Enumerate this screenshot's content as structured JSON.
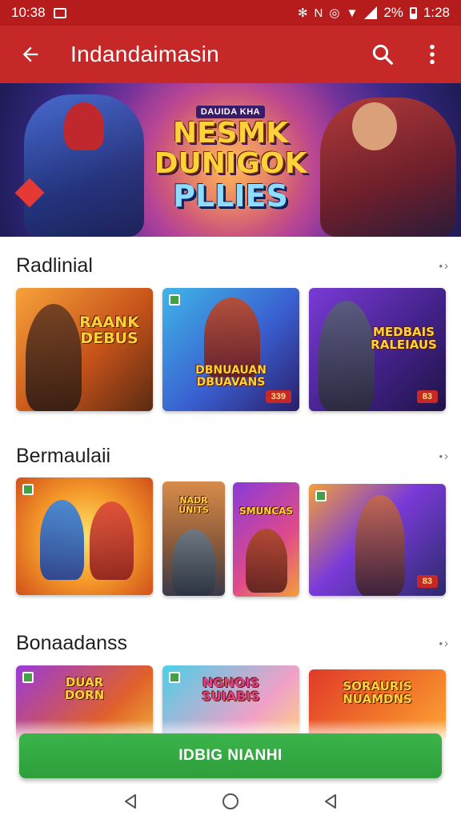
{
  "status_bar": {
    "time": "10:38",
    "battery": "2%",
    "clock_right": "1:28"
  },
  "app_bar": {
    "title": "Indandaimasin"
  },
  "hero": {
    "logo_small": "DAUIDA KHA",
    "logo_line1": "NESMK",
    "logo_line2": "DUNIGOK",
    "logo_line3": "PLLIES"
  },
  "sections": [
    {
      "title": "Radlinial",
      "more": "»",
      "cards": [
        {
          "text": "RAANK\nDEBUS",
          "badge": ""
        },
        {
          "text": "DBNUAUAN\nDBUAVANS",
          "badge": "339"
        },
        {
          "text": "MEDBAIS\nRALEIAUS",
          "badge": "83"
        }
      ]
    },
    {
      "title": "Bermaulaii",
      "more": "»",
      "cards": [
        {
          "text": "",
          "badge": ""
        },
        {
          "text": "NADR\nUNITS",
          "badge": ""
        },
        {
          "text": "SMUNCAS",
          "badge": ""
        },
        {
          "text": "",
          "badge": "83"
        }
      ]
    },
    {
      "title": "Bonaadanss",
      "more": "»",
      "cards": [
        {
          "text": "DUAR\nDORN"
        },
        {
          "text": "NGNOIS\nSUIABIS"
        },
        {
          "text": "SORAURIS\nNUAMDNS"
        }
      ]
    }
  ],
  "cta": {
    "label": "IDBIG NIANHI"
  },
  "colors": {
    "primary": "#c62828",
    "status": "#b71c1c",
    "cta": "#2e9e3b"
  }
}
